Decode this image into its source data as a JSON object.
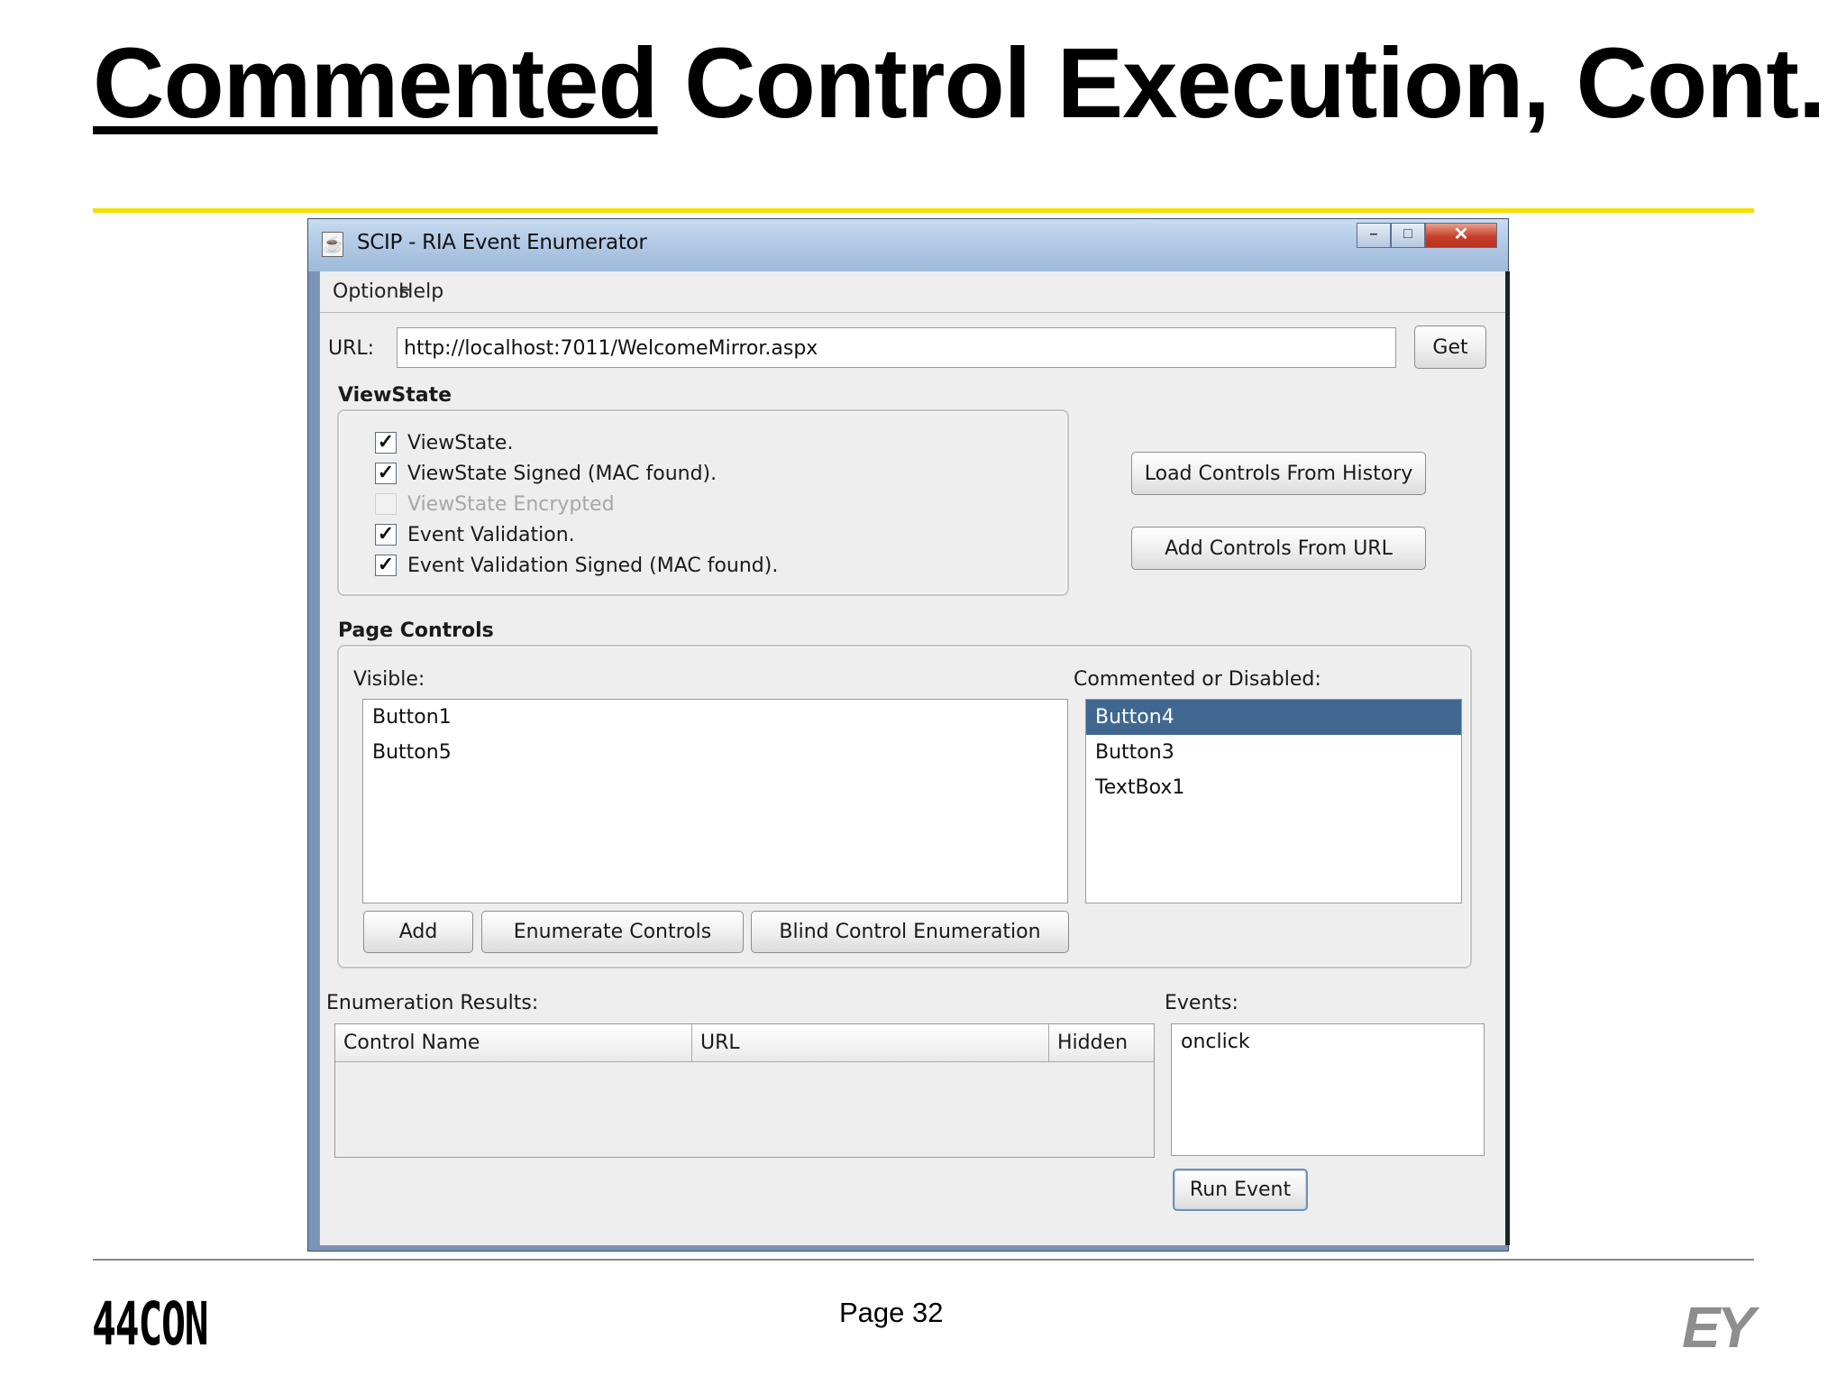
{
  "slide": {
    "title_underlined": "Commented",
    "title_rest": " Control Execution, Cont.",
    "footer_left_logo": "44CON",
    "page_label": "Page 32",
    "footer_right_logo": "EY"
  },
  "window": {
    "title": "SCIP - RIA Event Enumerator",
    "menu": [
      "Options",
      "Help"
    ],
    "url_label": "URL:",
    "url_value": "http://localhost:7011/WelcomeMirror.aspx",
    "get_button": "Get",
    "viewstate": {
      "heading": "ViewState",
      "checks": [
        {
          "label": "ViewState.",
          "checked": true,
          "enabled": true
        },
        {
          "label": "ViewState Signed (MAC found).",
          "checked": true,
          "enabled": true
        },
        {
          "label": "ViewState Encrypted",
          "checked": false,
          "enabled": false
        },
        {
          "label": "Event Validation.",
          "checked": true,
          "enabled": true
        },
        {
          "label": "Event Validation Signed (MAC found).",
          "checked": true,
          "enabled": true
        }
      ]
    },
    "load_history_button": "Load Controls From History",
    "add_url_button": "Add Controls From URL",
    "page_controls": {
      "heading": "Page Controls",
      "visible_label": "Visible:",
      "visible_items": [
        "Button1",
        "Button5"
      ],
      "commented_label": "Commented or Disabled:",
      "commented_items": [
        "Button4",
        "Button3",
        "TextBox1"
      ],
      "selected_commented": "Button4",
      "add_button": "Add",
      "enumerate_button": "Enumerate Controls",
      "blind_button": "Blind Control Enumeration"
    },
    "results": {
      "label": "Enumeration Results:",
      "columns": [
        "Control Name",
        "URL",
        "Hidden"
      ]
    },
    "events": {
      "label": "Events:",
      "items": [
        "onclick"
      ],
      "run_button": "Run Event"
    }
  },
  "colors": {
    "accent_rule": "#f5e000",
    "selection": "#3f6790",
    "titlebar": "#b2cae6"
  }
}
